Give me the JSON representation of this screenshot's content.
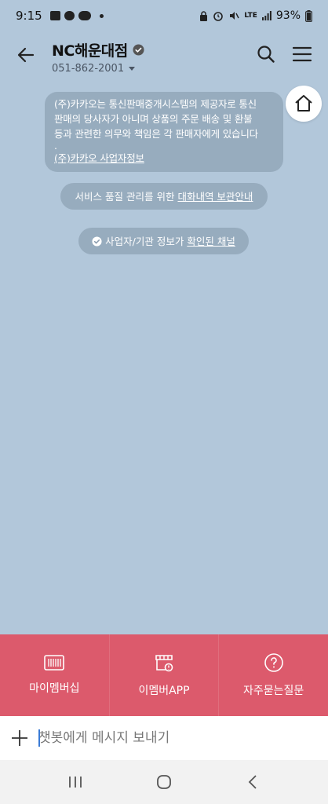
{
  "status_bar": {
    "time": "9:15",
    "battery": "93%",
    "network": "LTE"
  },
  "header": {
    "title": "NC해운대점",
    "phone": "051-862-2001"
  },
  "notices": {
    "main_lines": [
      "(주)카카오는 통신판매중개시스템의 제공자로 통신",
      "판매의 당사자가 아니며 상품의 주문 배송 및 환불",
      "등과 관련한 의무와 책임은 각 판매자에게 있습니다",
      "."
    ],
    "main_link": "(주)카카오 사업자정보",
    "pill1_text": "서비스 품질 관리를 위한 ",
    "pill1_link": "대화내역 보관안내",
    "pill2_text": "사업자/기관 정보가 ",
    "pill2_link": "확인된 채널"
  },
  "bottom_menu": {
    "items": [
      {
        "label": "마이멤버십",
        "icon": "barcode-icon"
      },
      {
        "label": "이멤버APP",
        "icon": "store-icon"
      },
      {
        "label": "자주묻는질문",
        "icon": "question-icon"
      }
    ]
  },
  "input": {
    "placeholder": "챗봇에게 메시지 보내기"
  },
  "colors": {
    "chat_bg": "#b2c7da",
    "menu_bg": "#dc5a6c",
    "notice_bg": "#8296a8"
  }
}
